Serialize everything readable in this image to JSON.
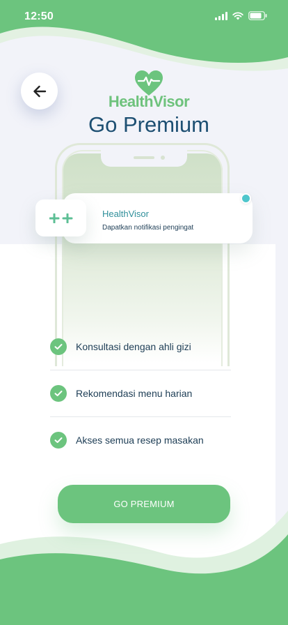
{
  "status_bar": {
    "time": "12:50"
  },
  "brand": {
    "name": "HealthVisor"
  },
  "page": {
    "title": "Go Premium"
  },
  "notification": {
    "app_name": "HealthVisor",
    "message": "Dapatkan notifikasi pengingat"
  },
  "features": [
    {
      "label": "Konsultasi dengan ahli gizi"
    },
    {
      "label": "Rekomendasi menu harian"
    },
    {
      "label": "Akses semua resep masakan"
    }
  ],
  "cta": {
    "label": "GO PREMIUM"
  },
  "colors": {
    "accent_green": "#6cc47e",
    "title_navy": "#1d4f72",
    "notification_dot": "#4fc6cc",
    "background": "#f2f3f9"
  },
  "icons": {
    "back": "arrow-left-icon",
    "logo": "heart-pulse-icon",
    "notification_app": "plus-plus-icon",
    "feature_check": "check-icon"
  }
}
